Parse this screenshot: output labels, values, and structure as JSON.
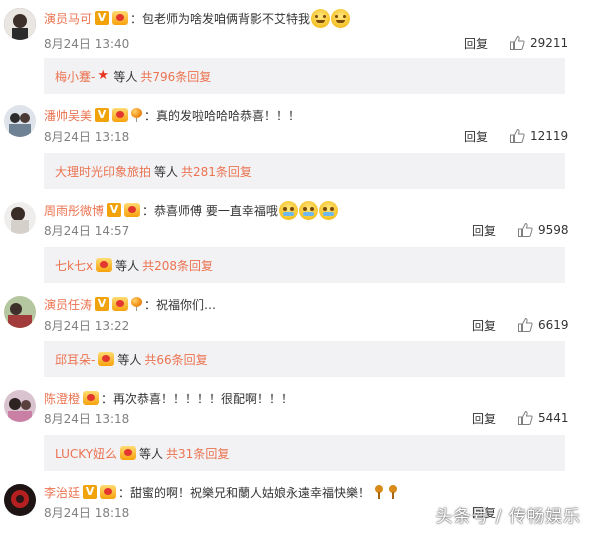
{
  "comments": [
    {
      "username": "演员马可",
      "badges": [
        "v-icon",
        "vip-icon"
      ],
      "text": "包老师为啥发咱俩背影不艾特我",
      "emoji": [
        "smile-icon",
        "smile-icon"
      ],
      "time": "8月24日 13:40",
      "reply_label": "回复",
      "likes": "29211",
      "sub": {
        "user": "梅小蹇-",
        "mid": "等人",
        "total": "共796条回复",
        "badge": "star-icon"
      },
      "avatar_color": "#5a4a42"
    },
    {
      "username": "潘帅吴美",
      "badges": [
        "v-icon",
        "vip-icon",
        "balloon-icon"
      ],
      "text": "真的发啦哈哈哈恭喜！！！",
      "emoji": [],
      "time": "8月24日 13:18",
      "reply_label": "回复",
      "likes": "12119",
      "sub": {
        "user": "大理时光印象旅拍",
        "mid": "等人",
        "total": "共281条回复"
      },
      "avatar_color": "#8aa0b8"
    },
    {
      "username": "周雨彤微博",
      "badges": [
        "v-icon",
        "vip-icon"
      ],
      "text": "恭喜师傅 要一直幸福哦",
      "emoji": [
        "cry-icon",
        "cry-icon",
        "cry-icon"
      ],
      "time": "8月24日 14:57",
      "reply_label": "回复",
      "likes": "9598",
      "sub": {
        "user": "七k七x",
        "mid": "等人",
        "total": "共208条回复",
        "badge": "vip-icon"
      },
      "avatar_color": "#c9bfb8"
    },
    {
      "username": "演员任涛",
      "badges": [
        "v-icon",
        "vip-icon",
        "balloon-icon"
      ],
      "text": "祝福你们…",
      "emoji": [],
      "time": "8月24日 13:22",
      "reply_label": "回复",
      "likes": "6619",
      "sub": {
        "user": "邱耳朵-",
        "mid": "等人",
        "total": "共66条回复",
        "badge": "vip-icon"
      },
      "avatar_color": "#7a6a5a"
    },
    {
      "username": "陈澄橙",
      "badges": [
        "vip-icon"
      ],
      "text": "再次恭喜！！！！！很配啊！！！",
      "emoji": [],
      "time": "8月24日 13:18",
      "reply_label": "回复",
      "likes": "5441",
      "sub": {
        "user": "LUCKY妞么",
        "mid": "等人",
        "total": "共31条回复",
        "badge": "vip-icon"
      },
      "avatar_color": "#c98aa0"
    },
    {
      "username": "李治廷",
      "badges": [
        "v-icon",
        "vip-icon"
      ],
      "text": "甜蜜的啊！祝樂兄和蘭人姑娘永遠幸福快樂！",
      "emoji": [
        "beer-icon",
        "beer-icon"
      ],
      "time": "8月24日 18:18",
      "reply_label": "回复",
      "likes": "",
      "sub": null,
      "avatar_color": "#3a2a2a"
    }
  ],
  "watermark": "头条号 / 传畅娱乐",
  "colors": {
    "username": "#eb7350",
    "time": "#808080",
    "subbox_bg": "#f2f2f5"
  }
}
